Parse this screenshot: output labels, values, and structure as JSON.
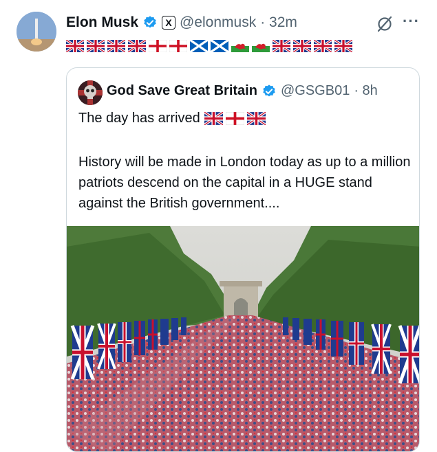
{
  "tweet": {
    "author_name": "Elon Musk",
    "handle": "@elonmusk",
    "time": "· 32m",
    "x_badge": "X",
    "more_label": "···",
    "flags": [
      "uk",
      "uk",
      "uk",
      "uk",
      "england",
      "england",
      "scotland",
      "scotland",
      "wales",
      "wales",
      "uk",
      "uk",
      "uk",
      "uk"
    ]
  },
  "quote": {
    "author_name": "God Save Great Britain",
    "handle": "@GSGB01",
    "time": "· 8h",
    "line1": "The day has arrived",
    "line1_flags": [
      "uk",
      "england",
      "uk"
    ],
    "body": "History will be made in London today as up to a million patriots descend on the capital in a HUGE stand against the British government...."
  },
  "colors": {
    "verified_blue": "#1d9bf0",
    "secondary_text": "#536471",
    "card_border": "#cfd9de"
  }
}
